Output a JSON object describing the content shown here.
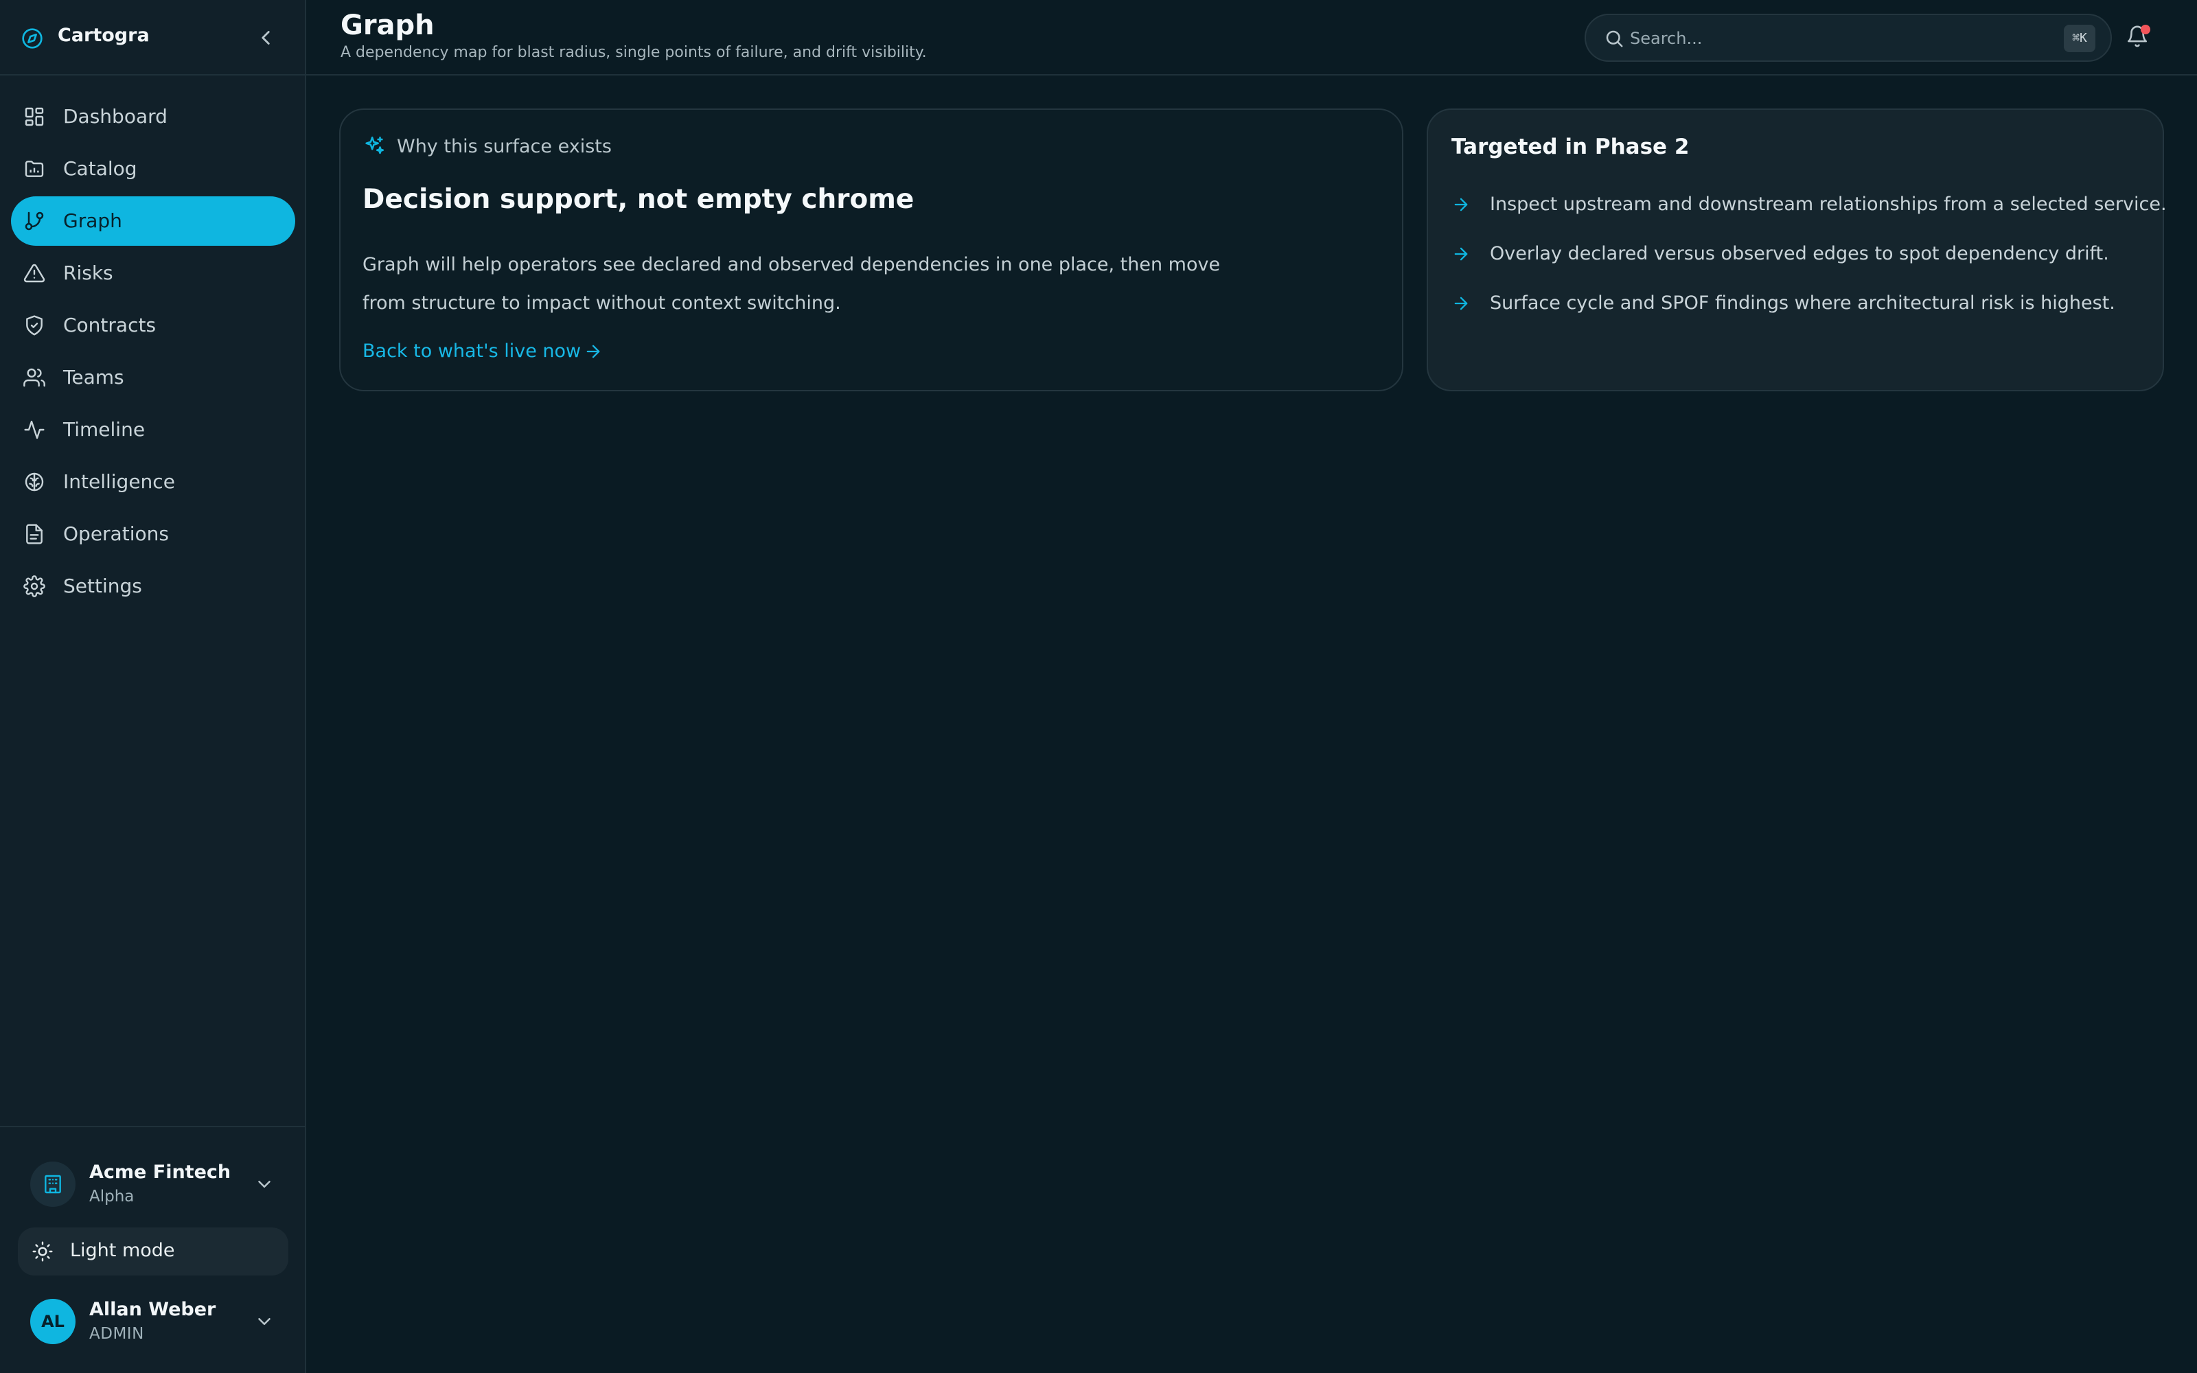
{
  "colors": {
    "background": "#0a1b23",
    "sidebar": "#112029",
    "accent": "#0fb6e0",
    "notification_dot": "#f2555a"
  },
  "brand": {
    "name": "Cartogra",
    "logo_icon": "compass-icon",
    "collapse_icon": "chevron-left-icon"
  },
  "sidebar": {
    "items": [
      {
        "label": "Dashboard",
        "icon": "dashboard-icon",
        "active": false
      },
      {
        "label": "Catalog",
        "icon": "folder-icon",
        "active": false
      },
      {
        "label": "Graph",
        "icon": "git-branch-icon",
        "active": true
      },
      {
        "label": "Risks",
        "icon": "warning-triangle-icon",
        "active": false
      },
      {
        "label": "Contracts",
        "icon": "shield-check-icon",
        "active": false
      },
      {
        "label": "Teams",
        "icon": "users-icon",
        "active": false
      },
      {
        "label": "Timeline",
        "icon": "activity-icon",
        "active": false
      },
      {
        "label": "Intelligence",
        "icon": "brain-icon",
        "active": false
      },
      {
        "label": "Operations",
        "icon": "document-icon",
        "active": false
      },
      {
        "label": "Settings",
        "icon": "gear-icon",
        "active": false
      }
    ]
  },
  "org": {
    "name": "Acme Fintech",
    "plan": "Alpha",
    "icon": "building-icon"
  },
  "theme": {
    "label": "Light mode",
    "icon": "sun-icon"
  },
  "user": {
    "initials": "AL",
    "name": "Allan Weber",
    "role": "ADMIN"
  },
  "header": {
    "title": "Graph",
    "subtitle": "A dependency map for blast radius, single points of failure, and drift visibility.",
    "search_placeholder": "Search...",
    "search_shortcut": "⌘K"
  },
  "card_main": {
    "eyebrow": "Why this surface exists",
    "heading": "Decision support, not empty chrome",
    "body": "Graph will help operators see declared and observed dependencies in one place, then move from structure to impact without context switching.",
    "link": "Back to what's live now"
  },
  "card_phase": {
    "title": "Targeted in Phase 2",
    "items": [
      "Inspect upstream and downstream relationships from a selected service.",
      "Overlay declared versus observed edges to spot dependency drift.",
      "Surface cycle and SPOF findings where architectural risk is highest."
    ]
  }
}
